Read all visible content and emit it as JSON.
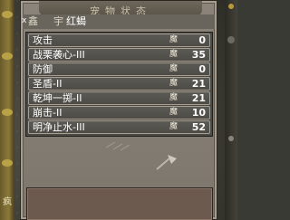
{
  "window": {
    "title": "宠物状态",
    "tab_a": "鑫",
    "tab_b": "宇",
    "pet_name": "红蝎",
    "close_glyph": "x"
  },
  "skills": [
    {
      "name": "攻击",
      "cost_label": "魔",
      "cost": "0"
    },
    {
      "name": "战栗袭心-III",
      "cost_label": "魔",
      "cost": "35"
    },
    {
      "name": "防御",
      "cost_label": "魔",
      "cost": "0"
    },
    {
      "name": "圣盾-II",
      "cost_label": "魔",
      "cost": "21"
    },
    {
      "name": "乾坤一掷-II",
      "cost_label": "魔",
      "cost": "21"
    },
    {
      "name": "崩击-II",
      "cost_label": "魔",
      "cost": "10"
    },
    {
      "name": "明净止水-III",
      "cost_label": "魔",
      "cost": "52"
    }
  ],
  "side": {
    "left_label": "疯"
  },
  "description": "",
  "colors": {
    "window_bg": "#8a847a",
    "row_bg": "#555350",
    "desc_bg": "#6d5a4e"
  },
  "icons": {
    "close": "close-icon",
    "axe": "axe-icon"
  }
}
